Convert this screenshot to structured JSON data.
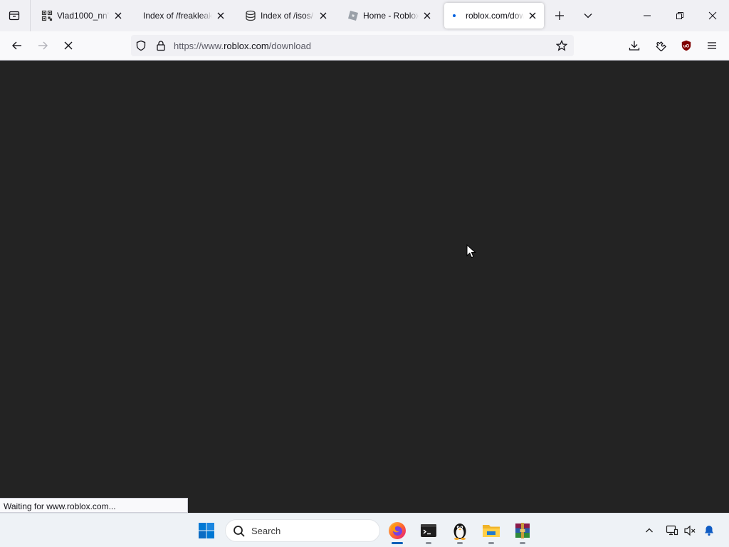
{
  "browser": {
    "tabs": [
      {
        "title": "Vlad1000_nn's P",
        "favicon": "qr-code-icon",
        "active": false
      },
      {
        "title": "Index of /freakleak/H",
        "favicon": "none",
        "active": false
      },
      {
        "title": "Index of /isos/",
        "favicon": "archive-icon",
        "active": false
      },
      {
        "title": "Home - Roblox",
        "favicon": "roblox-icon",
        "active": false
      },
      {
        "title": "roblox.com/dow",
        "favicon": "loading-dot-icon",
        "active": true
      }
    ],
    "url": {
      "scheme": "https://www.",
      "host": "roblox.com",
      "path": "/download"
    },
    "status_text": "Waiting for www.roblox.com...",
    "colors": {
      "content_bg": "#232323",
      "accent": "#0060df",
      "ublock_red": "#800000"
    }
  },
  "taskbar": {
    "search_placeholder": "Search",
    "pinned": [
      {
        "name": "firefox",
        "running": true,
        "active": true
      },
      {
        "name": "terminal",
        "running": true,
        "active": false
      },
      {
        "name": "tux",
        "running": true,
        "active": false
      },
      {
        "name": "file-explorer",
        "running": true,
        "active": false
      },
      {
        "name": "winrar",
        "running": true,
        "active": false
      }
    ]
  }
}
